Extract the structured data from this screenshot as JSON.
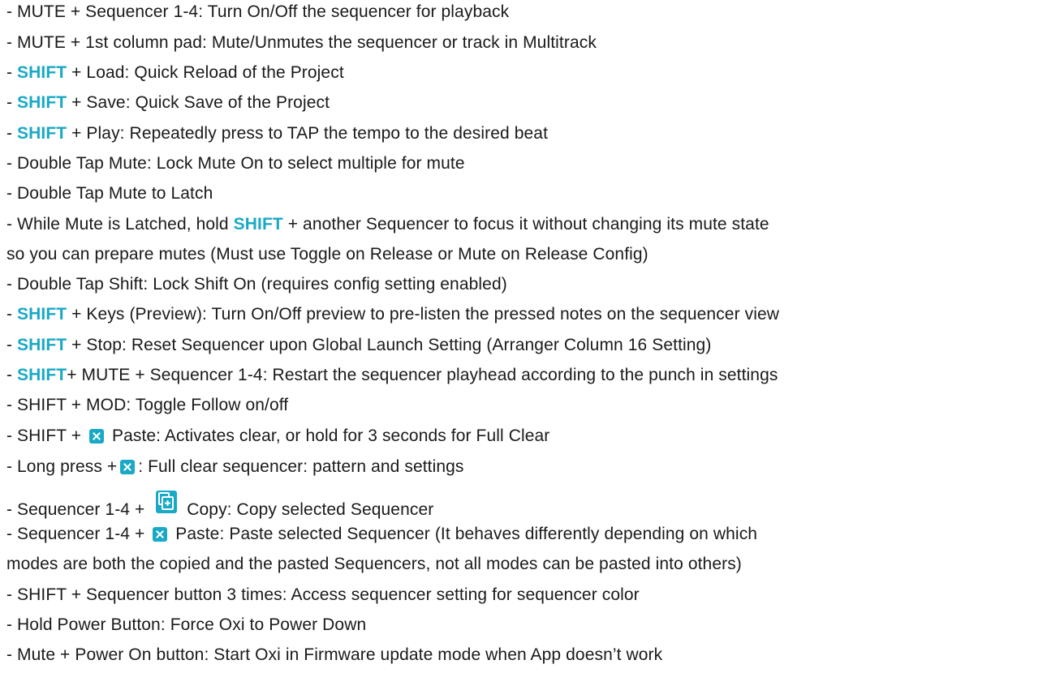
{
  "accent": "#19a9c7",
  "plus": " + ",
  "lines": [
    {
      "text": "- MUTE + Sequencer 1-4: Turn On/Off the sequencer for playback"
    },
    {
      "text": "- MUTE + 1st column pad: Mute/Unmutes the sequencer or track in Multitrack"
    },
    {
      "pre": "- ",
      "kw": "SHIFT",
      "text": " + Load: Quick Reload of the Project"
    },
    {
      "pre": "- ",
      "kw": "SHIFT",
      "text": " + Save: Quick Save of the Project"
    },
    {
      "pre": "- ",
      "kw": "SHIFT",
      "text": " + Play: Repeatedly press to TAP the tempo to the desired beat"
    },
    {
      "text": "- Double Tap Mute: Lock Mute On to select multiple for mute"
    },
    {
      "text": "- Double Tap Mute to Latch"
    },
    {
      "pre": "- While Mute is Latched, hold ",
      "kw": "SHIFT",
      "text": " + another Sequencer to focus it without changing its mute state"
    },
    {
      "text": "so you can prepare mutes (Must use Toggle on Release or Mute on Release Config)"
    },
    {
      "text": "- Double Tap Shift: Lock Shift On (requires config setting enabled)"
    },
    {
      "pre": "- ",
      "kw": "SHIFT",
      "text": " + Keys (Preview): Turn On/Off preview to pre-listen the pressed notes on the sequencer view"
    },
    {
      "pre": "- ",
      "kw": "SHIFT",
      "text": " + Stop: Reset Sequencer upon Global Launch Setting (Arranger Column 16 Setting)"
    },
    {
      "pre": "- ",
      "kw": "SHIFT",
      "text": "+ MUTE + Sequencer 1-4: Restart the sequencer playhead according to the punch in settings"
    },
    {
      "text": "- SHIFT + MOD: Toggle Follow on/off"
    },
    {
      "pre": "- SHIFT + ",
      "icon": "paste-icon",
      "text": " Paste: Activates clear, or hold for 3 seconds for Full Clear"
    },
    {
      "pre": "- Long press +",
      "icon": "paste-icon",
      "text": ": Full clear sequencer: pattern and settings"
    },
    {
      "pre": "- Sequencer 1-4 + ",
      "icon": "copy-icon",
      "text": " Copy: Copy selected Sequencer"
    },
    {
      "pre": "- Sequencer 1-4 + ",
      "icon": "paste-icon",
      "text": " Paste: Paste selected Sequencer (It behaves differently depending on which"
    },
    {
      "text": "modes are both the copied and the pasted Sequencers, not all modes can be pasted into others)"
    },
    {
      "text": "- SHIFT + Sequencer button 3 times: Access sequencer setting for sequencer color"
    },
    {
      "text": "- Hold Power Button: Force Oxi to Power Down"
    },
    {
      "text": "- Mute + Power On button: Start Oxi in Firmware update mode when App doesn’t work"
    }
  ]
}
